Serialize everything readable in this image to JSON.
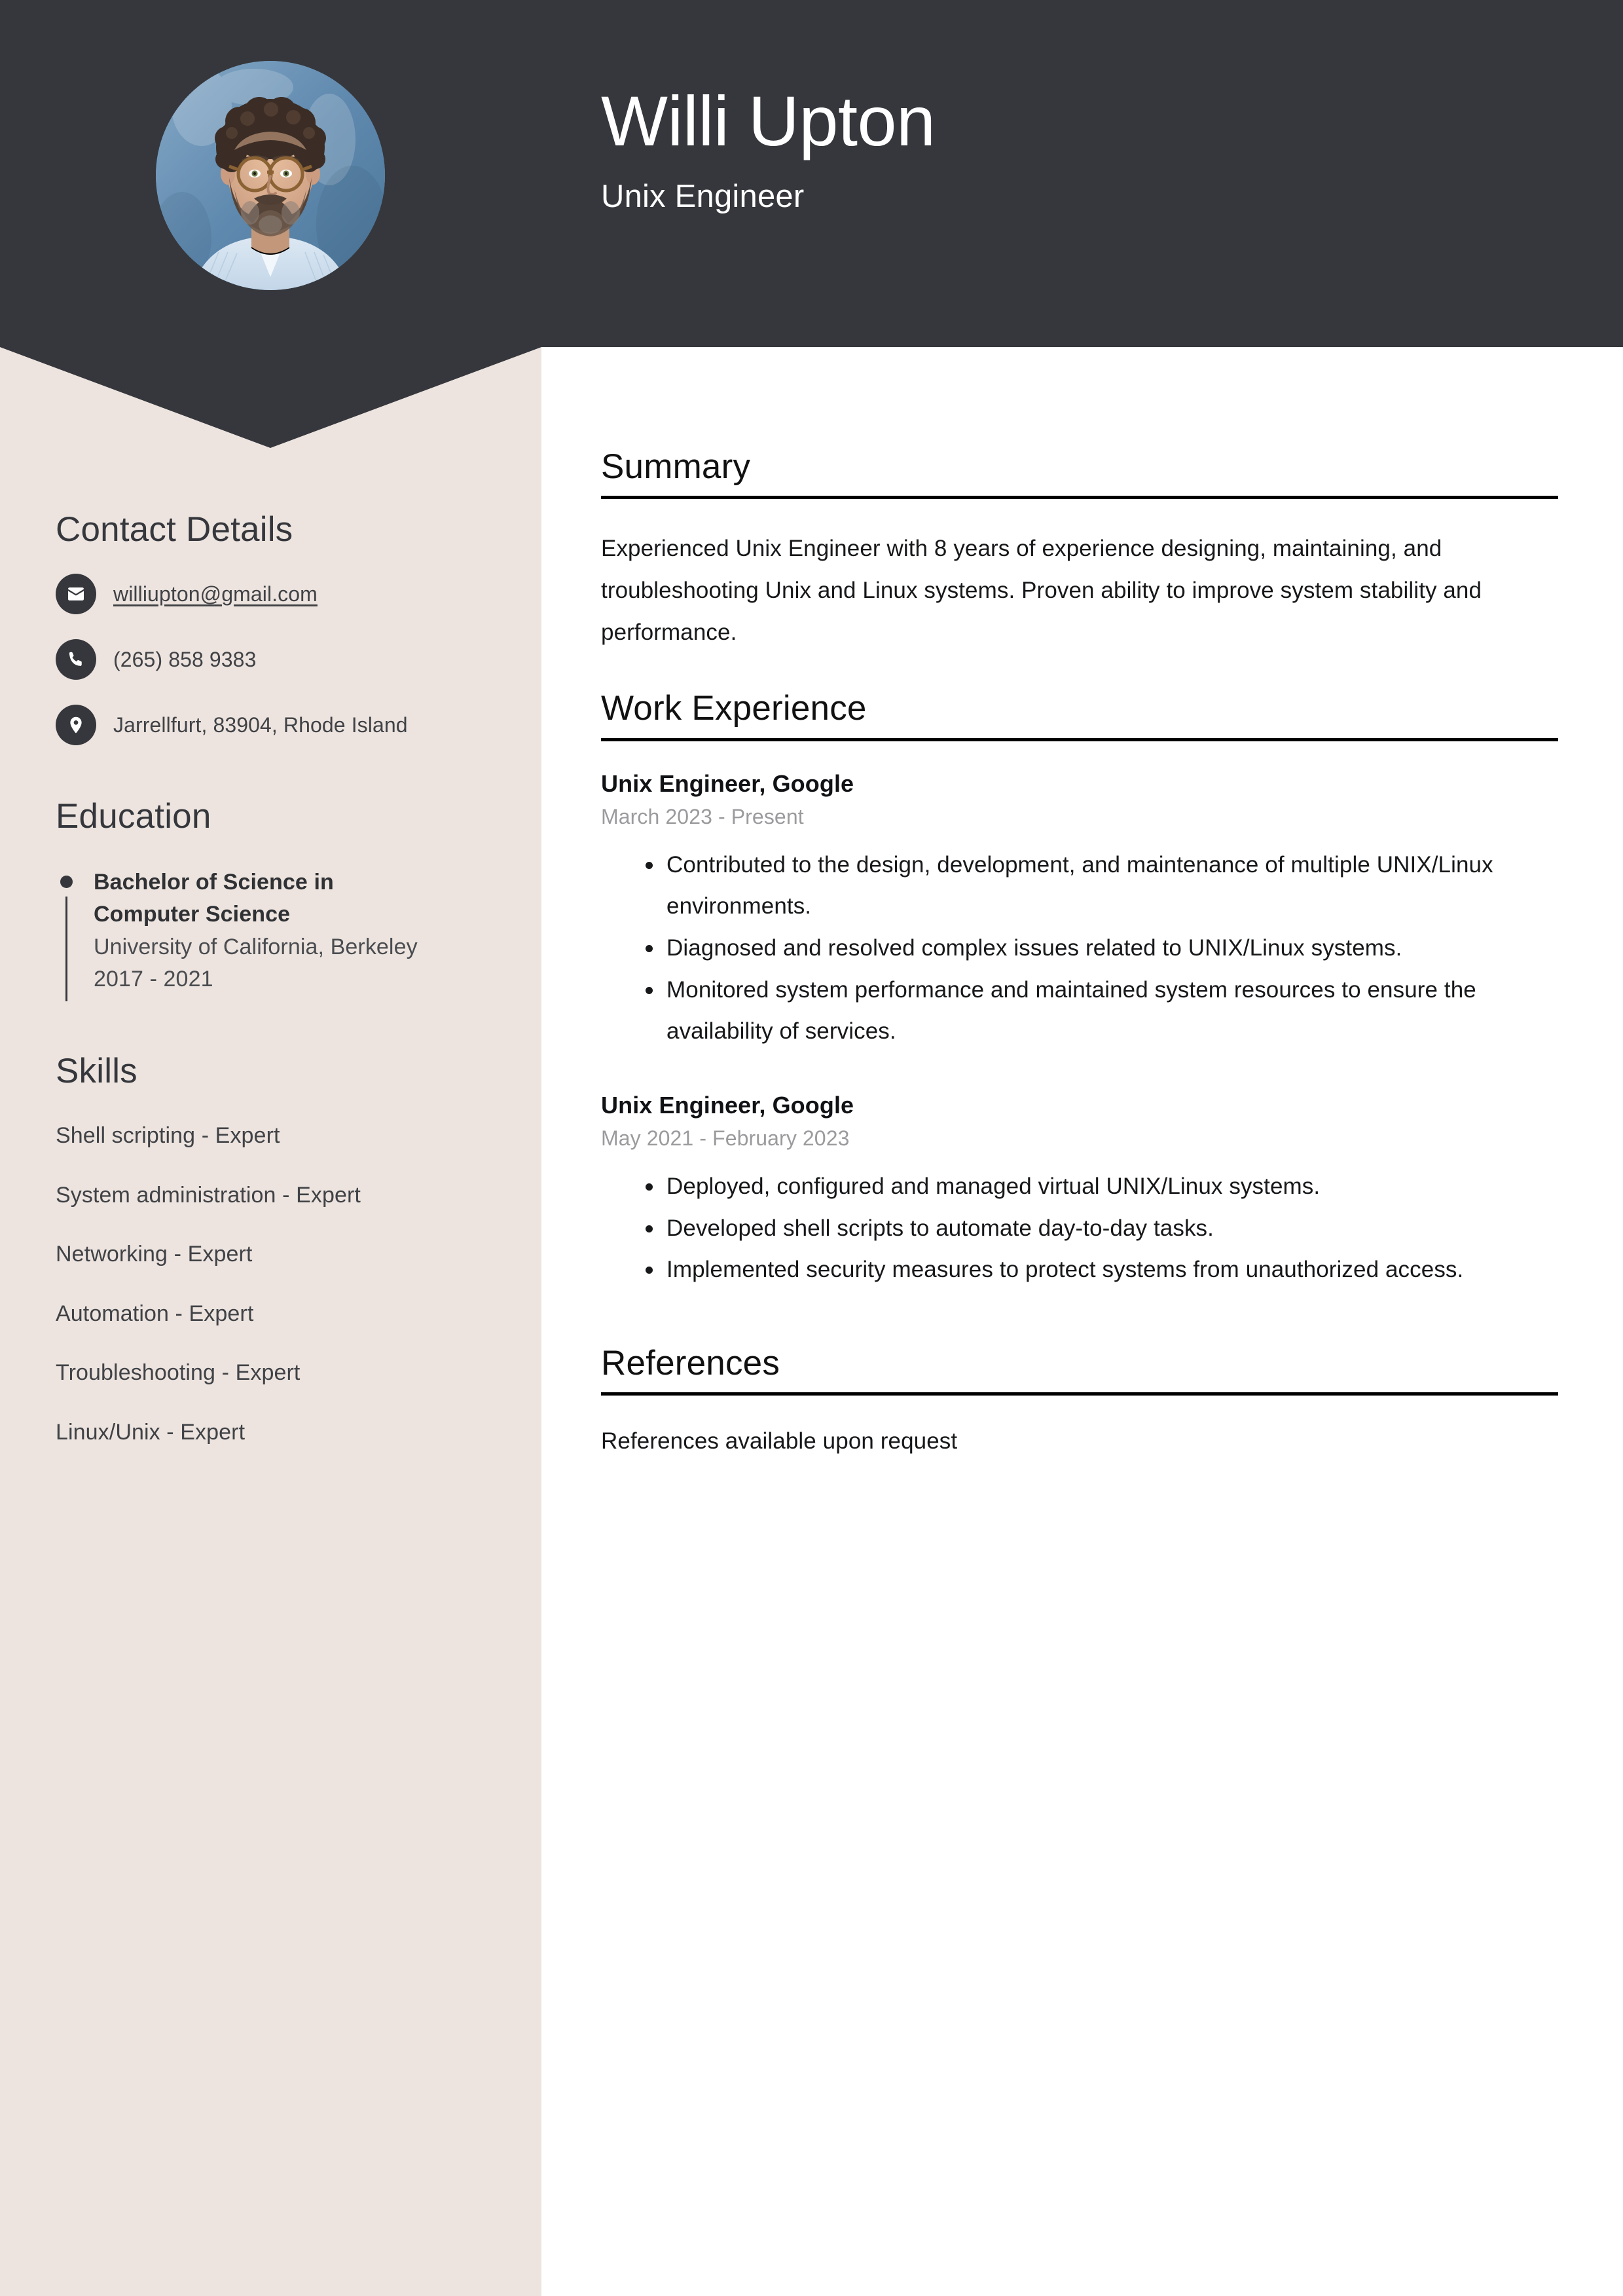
{
  "theme": {
    "header_bg": "#35373C",
    "sidebar_bg": "#EDE4DF",
    "main_bg": "#FFFFFF",
    "accent_dark": "#35373C",
    "muted_text": "#9B9B9E"
  },
  "header": {
    "name": "Willi Upton",
    "job_title": "Unix Engineer",
    "avatar_alt": "profile-photo"
  },
  "sidebar": {
    "contact": {
      "heading": "Contact Details",
      "items": [
        {
          "icon": "envelope-icon",
          "value": "williupton@gmail.com",
          "kind": "email"
        },
        {
          "icon": "phone-icon",
          "value": "(265) 858 9383",
          "kind": "phone"
        },
        {
          "icon": "map-pin-icon",
          "value": "Jarrellfurt, 83904, Rhode Island",
          "kind": "address"
        }
      ]
    },
    "education": {
      "heading": "Education",
      "items": [
        {
          "degree": "Bachelor of Science in Computer Science",
          "school": "University of California, Berkeley",
          "dates": "2017 - 2021"
        }
      ]
    },
    "skills": {
      "heading": "Skills",
      "items": [
        "Shell scripting - Expert",
        "System administration - Expert",
        "Networking - Expert",
        "Automation - Expert",
        "Troubleshooting - Expert",
        "Linux/Unix - Expert"
      ]
    }
  },
  "main": {
    "summary": {
      "heading": "Summary",
      "text": "Experienced Unix Engineer with 8 years of experience designing, maintaining, and troubleshooting Unix and Linux systems. Proven ability to improve system stability and performance."
    },
    "work_experience": {
      "heading": "Work Experience",
      "jobs": [
        {
          "title": "Unix Engineer, Google",
          "dates": "March 2023 - Present",
          "bullets": [
            "Contributed to the design, development, and maintenance of multiple UNIX/Linux environments.",
            "Diagnosed and resolved complex issues related to UNIX/Linux systems.",
            "Monitored system performance and maintained system resources to ensure the availability of services."
          ]
        },
        {
          "title": "Unix Engineer, Google",
          "dates": "May 2021 - February 2023",
          "bullets": [
            "Deployed, configured and managed virtual UNIX/Linux systems.",
            "Developed shell scripts to automate day-to-day tasks.",
            "Implemented security measures to protect systems from unauthorized access."
          ]
        }
      ]
    },
    "references": {
      "heading": "References",
      "text": "References available upon request"
    }
  }
}
